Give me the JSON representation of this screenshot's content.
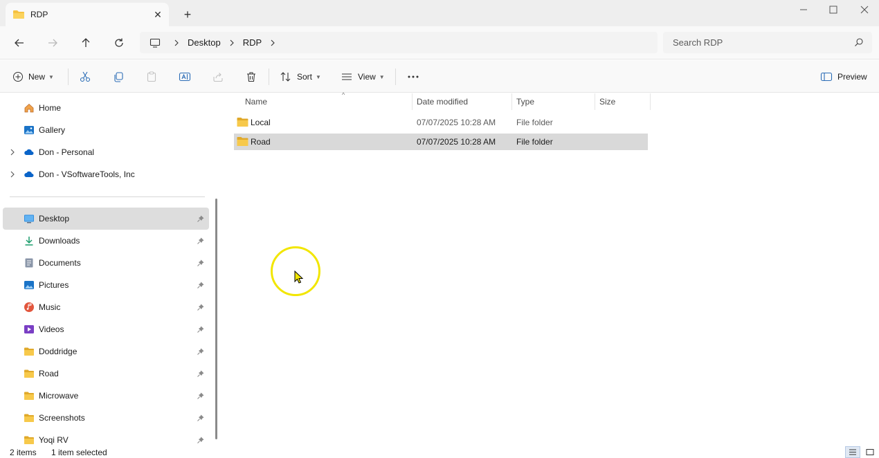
{
  "tab": {
    "title": "RDP"
  },
  "search": {
    "placeholder": "Search RDP"
  },
  "breadcrumb": [
    "Desktop",
    "RDP"
  ],
  "commands": {
    "new": "New",
    "sort": "Sort",
    "view": "View",
    "preview": "Preview"
  },
  "sidebar": {
    "top_items": [
      {
        "label": "Home",
        "icon": "home-icon"
      },
      {
        "label": "Gallery",
        "icon": "gallery-icon"
      },
      {
        "label": "Don - Personal",
        "icon": "onedrive-icon"
      },
      {
        "label": "Don - VSoftwareTools, Inc",
        "icon": "onedrive-icon"
      }
    ],
    "pinned_items": [
      {
        "label": "Desktop",
        "icon": "desktop-icon",
        "selected": true
      },
      {
        "label": "Downloads",
        "icon": "downloads-icon"
      },
      {
        "label": "Documents",
        "icon": "documents-icon"
      },
      {
        "label": "Pictures",
        "icon": "pictures-icon"
      },
      {
        "label": "Music",
        "icon": "music-icon"
      },
      {
        "label": "Videos",
        "icon": "videos-icon"
      },
      {
        "label": "Doddridge",
        "icon": "folder-icon"
      },
      {
        "label": "Road",
        "icon": "folder-icon"
      },
      {
        "label": "Microwave",
        "icon": "folder-icon"
      },
      {
        "label": "Screenshots",
        "icon": "folder-icon"
      },
      {
        "label": "Yoqi RV",
        "icon": "folder-icon"
      }
    ]
  },
  "columns": {
    "name": "Name",
    "date": "Date modified",
    "type": "Type",
    "size": "Size"
  },
  "files": [
    {
      "name": "Local",
      "date": "07/07/2025 10:28 AM",
      "type": "File folder",
      "size": "",
      "selected": false
    },
    {
      "name": "Road",
      "date": "07/07/2025 10:28 AM",
      "type": "File folder",
      "size": "",
      "selected": true
    }
  ],
  "status": {
    "count": "2 items",
    "selection": "1 item selected"
  },
  "colors": {
    "folder": "#f5c242",
    "folder_dark": "#e0a92a",
    "selection": "#d9d9d9",
    "accent": "#0067c0",
    "cursor_ring": "#f2e600"
  }
}
